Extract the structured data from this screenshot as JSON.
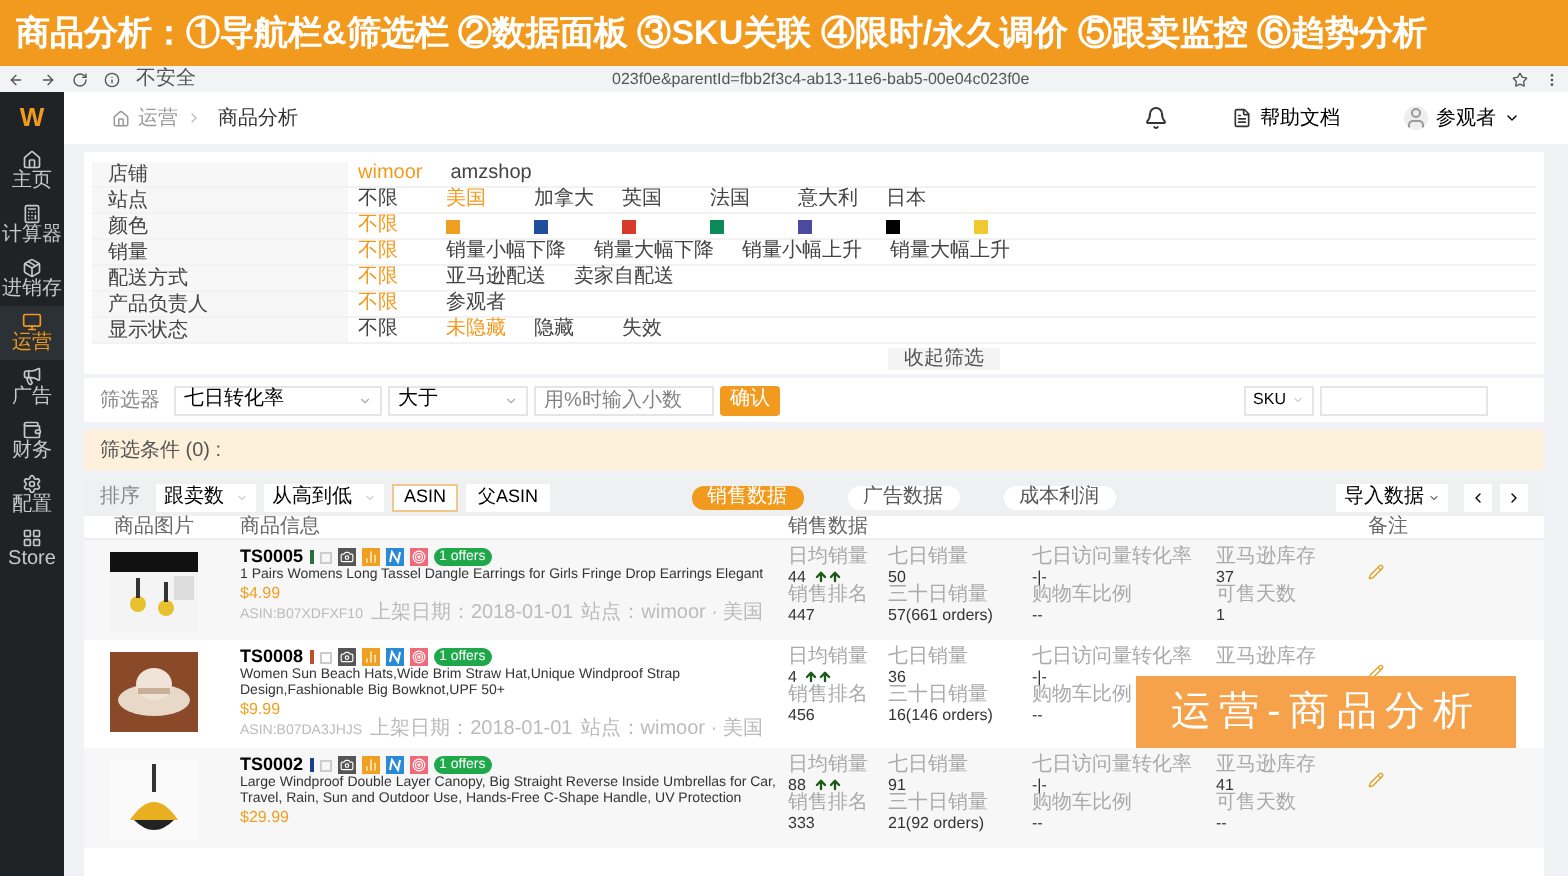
{
  "banner": {
    "title": "商品分析：①导航栏&筛选栏 ②数据面板 ③SKU关联 ④限时/永久调价 ⑤跟卖监控 ⑥趋势分析"
  },
  "browser": {
    "security": "不安全",
    "url": "023f0e&parentId=fbb2f3c4-ab13-11e6-bab5-00e04c023f0e"
  },
  "sidebar": {
    "logo": "W",
    "items": [
      {
        "label": "主页",
        "selected": false
      },
      {
        "label": "计算器",
        "selected": false
      },
      {
        "label": "进销存",
        "selected": false
      },
      {
        "label": "运营",
        "selected": true
      },
      {
        "label": "广告",
        "selected": false
      },
      {
        "label": "财务",
        "selected": false
      },
      {
        "label": "配置",
        "selected": false
      },
      {
        "label": "Store",
        "selected": false
      }
    ]
  },
  "header": {
    "breadcrumb": [
      "运营",
      "商品分析"
    ],
    "help": "帮助文档",
    "user": "参观者"
  },
  "filters": [
    {
      "label": "店铺",
      "options": [
        {
          "kind": "text",
          "label": "wimoor",
          "selected": true
        },
        {
          "kind": "text",
          "label": "amzshop",
          "selected": false
        }
      ]
    },
    {
      "label": "站点",
      "options": [
        {
          "kind": "text",
          "label": "不限",
          "selected": false
        },
        {
          "kind": "text",
          "label": "美国",
          "selected": true
        },
        {
          "kind": "text",
          "label": "加拿大",
          "selected": false
        },
        {
          "kind": "text",
          "label": "英国",
          "selected": false
        },
        {
          "kind": "text",
          "label": "法国",
          "selected": false
        },
        {
          "kind": "text",
          "label": "意大利",
          "selected": false
        },
        {
          "kind": "text",
          "label": "日本",
          "selected": false
        }
      ]
    },
    {
      "label": "颜色",
      "options": [
        {
          "kind": "text",
          "label": "不限",
          "selected": true
        },
        {
          "kind": "swatch",
          "color": "#f0a020",
          "selected": false
        },
        {
          "kind": "swatch",
          "color": "#1f4e9c",
          "selected": false
        },
        {
          "kind": "swatch",
          "color": "#d83a2a",
          "selected": false
        },
        {
          "kind": "swatch",
          "color": "#0d8a5a",
          "selected": false
        },
        {
          "kind": "swatch",
          "color": "#4a4aa0",
          "selected": false
        },
        {
          "kind": "swatch",
          "color": "#000000",
          "selected": false
        },
        {
          "kind": "swatch",
          "color": "#f0c830",
          "selected": false
        }
      ]
    },
    {
      "label": "销量",
      "options": [
        {
          "kind": "text",
          "label": "不限",
          "selected": true
        },
        {
          "kind": "text",
          "label": "销量小幅下降",
          "selected": false
        },
        {
          "kind": "text",
          "label": "销量大幅下降",
          "selected": false
        },
        {
          "kind": "text",
          "label": "销量小幅上升",
          "selected": false
        },
        {
          "kind": "text",
          "label": "销量大幅上升",
          "selected": false
        }
      ]
    },
    {
      "label": "配送方式",
      "options": [
        {
          "kind": "text",
          "label": "不限",
          "selected": true
        },
        {
          "kind": "text",
          "label": "亚马逊配送",
          "selected": false
        },
        {
          "kind": "text",
          "label": "卖家自配送",
          "selected": false
        }
      ]
    },
    {
      "label": "产品负责人",
      "options": [
        {
          "kind": "text",
          "label": "不限",
          "selected": true
        },
        {
          "kind": "text",
          "label": "参观者",
          "selected": false
        }
      ]
    },
    {
      "label": "显示状态",
      "options": [
        {
          "kind": "text",
          "label": "不限",
          "selected": false
        },
        {
          "kind": "text",
          "label": "未隐藏",
          "selected": true
        },
        {
          "kind": "text",
          "label": "隐藏",
          "selected": false
        },
        {
          "kind": "text",
          "label": "失效",
          "selected": false
        }
      ]
    }
  ],
  "collapse": "收起筛选",
  "filter_bar": {
    "label": "筛选器",
    "field": "七日转化率",
    "operator": "大于",
    "value_placeholder": "用%时输入小数",
    "confirm": "确认",
    "sku_select": "SKU"
  },
  "conditions": "筛选条件 (0) :",
  "toolbar": {
    "sort_label": "排序",
    "sort_field": "跟卖数",
    "sort_order": "从高到低",
    "asin_tabs": [
      {
        "label": "ASIN",
        "selected": true
      },
      {
        "label": "父ASIN",
        "selected": false
      }
    ],
    "data_tabs": [
      {
        "label": "销售数据",
        "selected": true
      },
      {
        "label": "广告数据",
        "selected": false
      },
      {
        "label": "成本利润",
        "selected": false
      }
    ],
    "import": "导入数据"
  },
  "columns": [
    "商品图片",
    "商品信息",
    "销售数据",
    "备注"
  ],
  "products": [
    {
      "sku": "TS0005",
      "color": "#2a6e3a",
      "offers": "1 offers",
      "title": "1 Pairs Womens Long Tassel Dangle Earrings for Girls Fringe Drop Earrings Elegant",
      "price": "$4.99",
      "asin": "ASIN:B07XDFXF10",
      "listed": "上架日期：2018-01-01",
      "site": "站点：wimoor · 美国",
      "stats": [
        {
          "label": "日均销量",
          "value": "44",
          "rising": true,
          "label2": "销售排名",
          "value2": "447"
        },
        {
          "label": "七日销量",
          "value": "50",
          "label2": "三十日销量",
          "value2": "57(661 orders)"
        },
        {
          "label": "七日访问量转化率",
          "value": "-|-",
          "label2": "购物车比例",
          "value2": "--"
        },
        {
          "label": "亚马逊库存",
          "value": "37",
          "label2": "可售天数",
          "value2": "1"
        }
      ]
    },
    {
      "sku": "TS0008",
      "color": "#c0502a",
      "offers": "1 offers",
      "title": "Women Sun Beach Hats,Wide Brim Straw Hat,Unique Windproof Strap Design,Fashionable Big Bowknot,UPF 50+",
      "price": "$9.99",
      "asin": "ASIN:B07DA3JHJS",
      "listed": "上架日期：2018-01-01",
      "site": "站点：wimoor · 美国",
      "stats": [
        {
          "label": "日均销量",
          "value": "4",
          "rising": true,
          "label2": "销售排名",
          "value2": "456"
        },
        {
          "label": "七日销量",
          "value": "36",
          "label2": "三十日销量",
          "value2": "16(146 orders)"
        },
        {
          "label": "七日访问量转化率",
          "value": "-|-",
          "label2": "购物车比例",
          "value2": "--"
        },
        {
          "label": "亚马逊库存"
        }
      ]
    },
    {
      "sku": "TS0002",
      "color": "#1f3e8c",
      "offers": "1 offers",
      "title": "Large Windproof Double Layer Canopy, Big Straight Reverse Inside Umbrellas for Car, Travel, Rain, Sun and Outdoor Use, Hands-Free C-Shape Handle, UV Protection",
      "price": "$29.99",
      "stats": [
        {
          "label": "日均销量",
          "value": "88",
          "rising": true,
          "label2": "销售排名",
          "value2": "333"
        },
        {
          "label": "七日销量",
          "value": "91",
          "label2": "三十日销量",
          "value2": "21(92 orders)"
        },
        {
          "label": "七日访问量转化率",
          "value": "-|-",
          "label2": "购物车比例",
          "value2": "--"
        },
        {
          "label": "亚马逊库存",
          "value": "41",
          "label2": "可售天数",
          "value2": "--"
        }
      ]
    }
  ],
  "caption": "运营-商品分析"
}
